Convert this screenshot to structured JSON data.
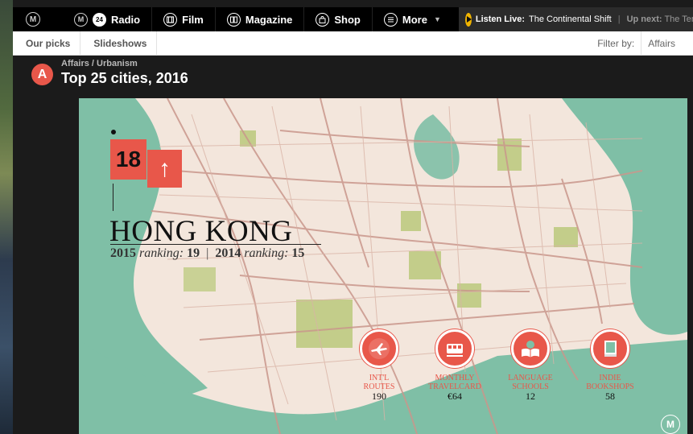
{
  "nav": {
    "logo": "M",
    "items": [
      {
        "label": "Radio",
        "icon": "m24-icon",
        "icon_text": "24"
      },
      {
        "label": "Film",
        "icon": "film-icon"
      },
      {
        "label": "Magazine",
        "icon": "magazine-icon"
      },
      {
        "label": "Shop",
        "icon": "shop-bag-icon"
      },
      {
        "label": "More",
        "icon": "menu-icon"
      }
    ],
    "listen_label": "Listen Live:",
    "listen_title": "The Continental Shift",
    "upnext_label": "Up next:",
    "upnext_title": "The Ten"
  },
  "subnav": {
    "tabs": [
      "Our picks",
      "Slideshows"
    ],
    "filter_label": "Filter by:",
    "filter_value": "Affairs"
  },
  "header": {
    "badge": "A",
    "breadcrumb": "Affairs / Urbanism",
    "title": "Top 25 cities, 2016"
  },
  "city": {
    "rank": "18",
    "trend_symbol": "↑",
    "name": "HONG KONG",
    "rank_2015_label": "2015",
    "rank_word_a": "ranking:",
    "rank_2015": "19",
    "rank_2014_label": "2014",
    "rank_word_b": "ranking:",
    "rank_2014": "15"
  },
  "stats": [
    {
      "label1": "INT'L",
      "label2": "ROUTES",
      "value": "190",
      "icon": "airplane-icon"
    },
    {
      "label1": "MONTHLY",
      "label2": "TRAVELCARD",
      "value": "€64",
      "icon": "train-icon"
    },
    {
      "label1": "LANGUAGE",
      "label2": "SCHOOLS",
      "value": "12",
      "icon": "open-book-icon"
    },
    {
      "label1": "INDIE",
      "label2": "BOOKSHOPS",
      "value": "58",
      "icon": "book-icon"
    }
  ],
  "watermark": "M",
  "colors": {
    "accent": "#e8574a",
    "water": "#7fbfa6",
    "land": "#f3e6dc",
    "park": "#b7c776",
    "road": "#c9978c",
    "listen_play": "#f0b400"
  }
}
